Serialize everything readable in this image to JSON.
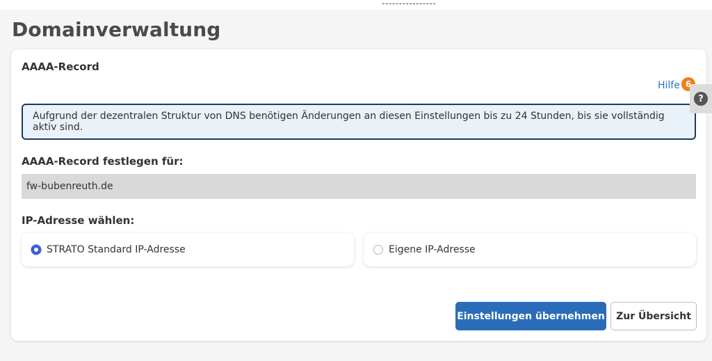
{
  "page": {
    "title": "Domainverwaltung"
  },
  "card": {
    "section_title": "AAAA-Record",
    "help_label": "Hilfe",
    "help_badge": "6",
    "info_text": "Aufgrund der dezentralen Struktur von DNS benötigen Änderungen an diesen Einstellungen bis zu 24 Stunden, bis sie vollständig aktiv sind.",
    "domain_label": "AAAA-Record festlegen für:",
    "domain_value": "fw-bubenreuth.de",
    "ip_label": "IP-Adresse wählen:",
    "ip_options": [
      {
        "label": "STRATO Standard IP-Adresse",
        "selected": true
      },
      {
        "label": "Eigene IP-Adresse",
        "selected": false
      }
    ],
    "buttons": {
      "apply": "Einstellungen übernehmen",
      "overview": "Zur Übersicht"
    }
  },
  "side_help": {
    "icon": "question-icon",
    "glyph": "?"
  },
  "colors": {
    "primary": "#2b6cb8",
    "badge": "#f07f1c",
    "info_bg": "#e8f2f8",
    "info_border": "#1f3a5c",
    "radio_accent": "#3c5bd6"
  }
}
